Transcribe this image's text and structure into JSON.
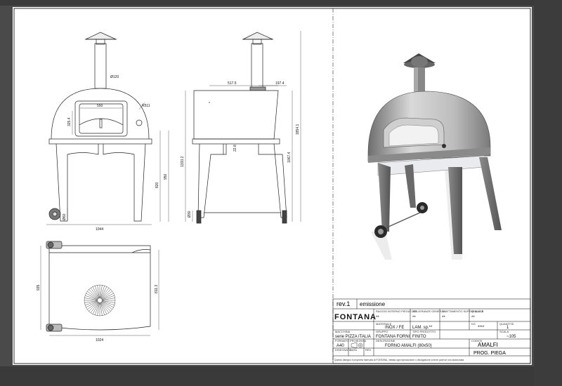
{
  "dimensions": {
    "flue_dia": "Ø120",
    "mouth_width": "550",
    "mouth_height": "325.4",
    "dome_radius": "R511",
    "front_width": "1044",
    "leg_height": "820",
    "total_front_height": "950",
    "wheel_height": "Ø60",
    "depth_517": "517.5",
    "depth_197": "197.4",
    "overall_height": "1854.1",
    "side_height_1": "1333.2",
    "side_height_2": "1067.4",
    "leg_spacing": "22.8",
    "wheel_side": "Ø30",
    "top_depth": "935",
    "top_right": "811.3",
    "top_width": "1024"
  },
  "title_block": {
    "rev_label": "rev.1",
    "rev_desc": "emissione",
    "brand": "FONTANA",
    "h_raggio": "RAGGIO INTERNO PIEGATURE",
    "v_raggio": "**",
    "h_tolleranze": "TOLLERANZE GENERALI",
    "v_tolleranze": "**",
    "h_trattamento": "TRATTAMENTO SUPERFICIALE",
    "v_trattamento": "**",
    "h_qualita": "QUALITÀ",
    "v_qualita": "**",
    "h_materiale": "MATERIALE",
    "v_materiale": "INOX / FE",
    "h_lam": "LAM. sp.**",
    "h_kg": "KG",
    "v_kg": "****",
    "h_quantita": "QUANTITÀ",
    "v_quantita": "1",
    "h_scala": "SCALA",
    "v_scala": "~105",
    "h_macchina": "MACCHINA",
    "v_macchina": "serie PIZZA ITALIA",
    "h_gruppo": "GRUPPO",
    "v_gruppo": "FONTANA FORNI",
    "h_tipo": "TIPO PRODOTTO",
    "v_tipo": "FINITO",
    "h_formato": "FORMATO",
    "v_formato": "A40",
    "h_proiezioni": "PROIEZIONI",
    "h_descrizione": "DESCRIZIONE",
    "v_descrizione": "FORNO AMALFI (80x50)",
    "h_codice": "CODICE",
    "v_codice": "AMALFI",
    "h_disegnato": "DISEGNATO",
    "h_data": "DATA",
    "h_rev": "REV",
    "v_prog": "PROG. PIEGA",
    "footer": "Questo disegno è proprietà riservata di FONTANA, vietata ogni riproduzione o divulgazione a terze parti se non autorizzata"
  }
}
